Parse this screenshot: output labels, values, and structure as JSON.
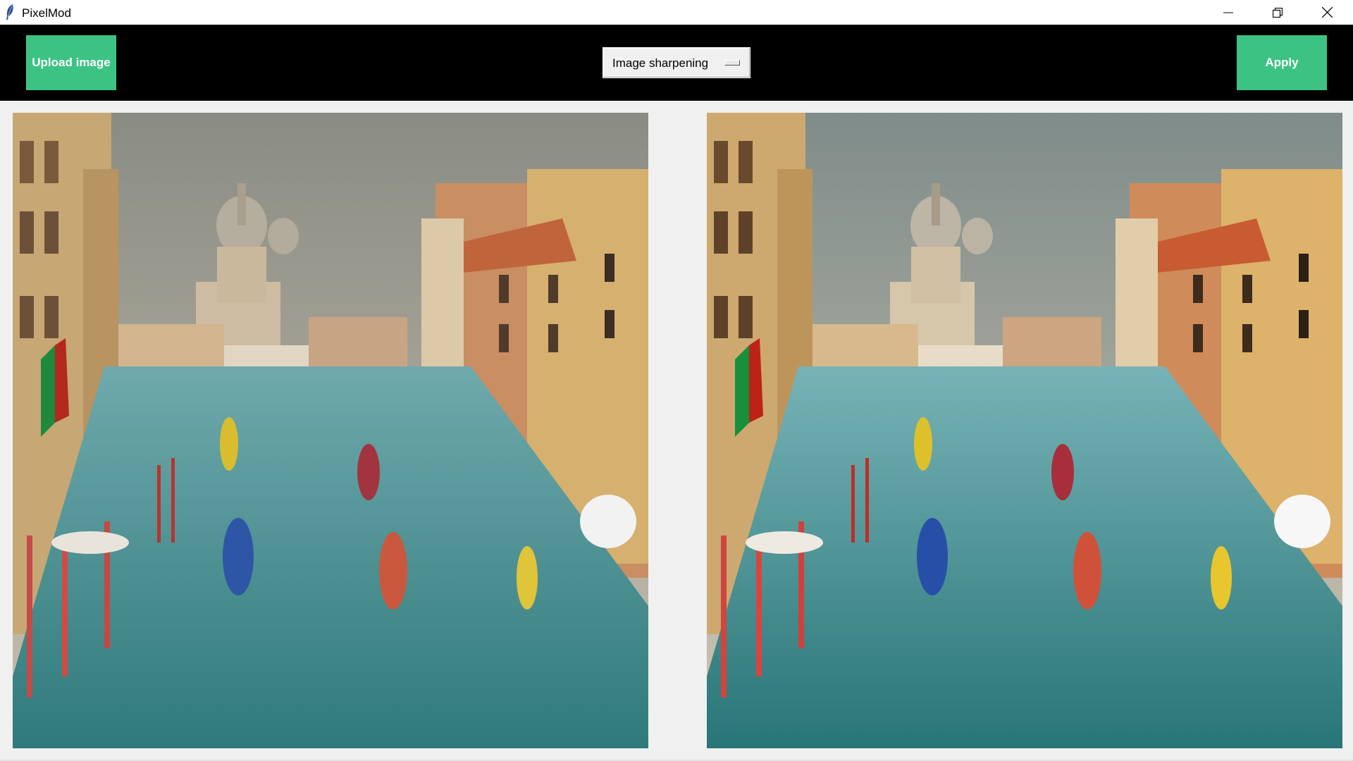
{
  "window": {
    "title": "PixelMod",
    "controls": [
      "minimize-icon",
      "restore-icon",
      "close-icon"
    ]
  },
  "toolbar": {
    "upload_label": "Upload image",
    "filter_selected": "Image sharpening",
    "apply_label": "Apply"
  },
  "panels": {
    "original": {
      "description_icon": "venice-canal-photo"
    },
    "processed": {
      "description_icon": "venice-canal-photo-sharpened"
    }
  },
  "colors": {
    "accent": "#3cc384",
    "toolbar_bg": "#000000",
    "window_bg": "#f0f0f0"
  }
}
